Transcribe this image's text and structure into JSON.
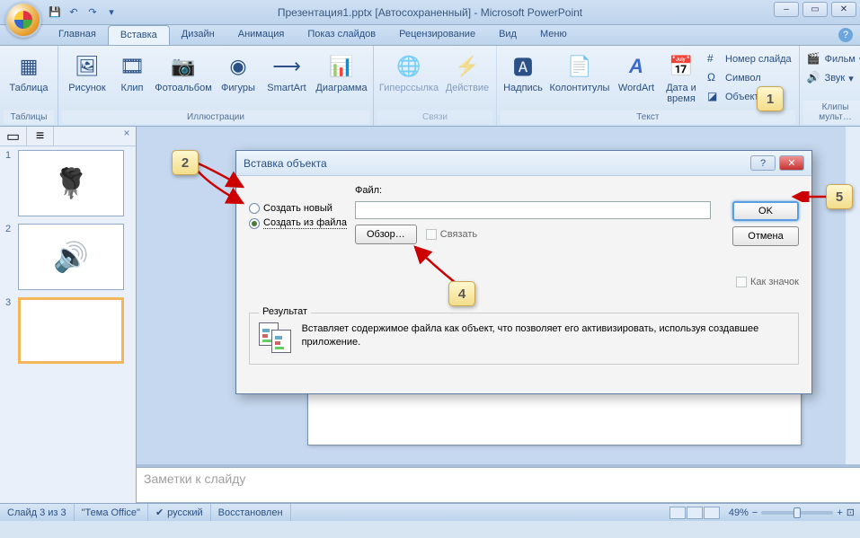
{
  "title": "Презентация1.pptx [Автосохраненный] - Microsoft PowerPoint",
  "tabs": {
    "home": "Главная",
    "insert": "Вставка",
    "design": "Дизайн",
    "anim": "Анимация",
    "show": "Показ слайдов",
    "review": "Рецензирование",
    "view": "Вид",
    "menu": "Меню"
  },
  "ribbon": {
    "tables": {
      "label": "Таблицы",
      "table": "Таблица"
    },
    "illus": {
      "label": "Иллюстрации",
      "picture": "Рисунок",
      "clip": "Клип",
      "album": "Фотоальбом",
      "shapes": "Фигуры",
      "smartart": "SmartArt",
      "chart": "Диаграмма"
    },
    "links": {
      "label": "Связи",
      "hyperlink": "Гиперссылка",
      "action": "Действие"
    },
    "text": {
      "label": "Текст",
      "textbox": "Надпись",
      "headerfooter": "Колонтитулы",
      "wordart": "WordArt",
      "datetime": "Дата и время",
      "slidenum": "Номер слайда",
      "symbol": "Символ",
      "object": "Объект"
    },
    "media": {
      "label": "Клипы мульт…",
      "movie": "Фильм",
      "sound": "Звук"
    }
  },
  "slides": {
    "s1": "1",
    "s2": "2",
    "s3": "3"
  },
  "notes": {
    "placeholder": "Заметки к слайду"
  },
  "status": {
    "slideof": "Слайд 3 из 3",
    "theme": "\"Тема Office\"",
    "lang": "русский",
    "recovered": "Восстановлен",
    "zoom": "49%"
  },
  "dialog": {
    "title": "Вставка объекта",
    "create_new": "Создать новый",
    "create_from_file": "Создать из файла",
    "file_label": "Файл:",
    "browse": "Обзор…",
    "link": "Связать",
    "as_icon": "Как значок",
    "ok": "OK",
    "cancel": "Отмена",
    "result_label": "Результат",
    "result_text": "Вставляет содержимое файла как объект, что позволяет его активизировать, используя создавшее приложение."
  },
  "callouts": {
    "c1": "1",
    "c2": "2",
    "c4": "4",
    "c5": "5"
  }
}
